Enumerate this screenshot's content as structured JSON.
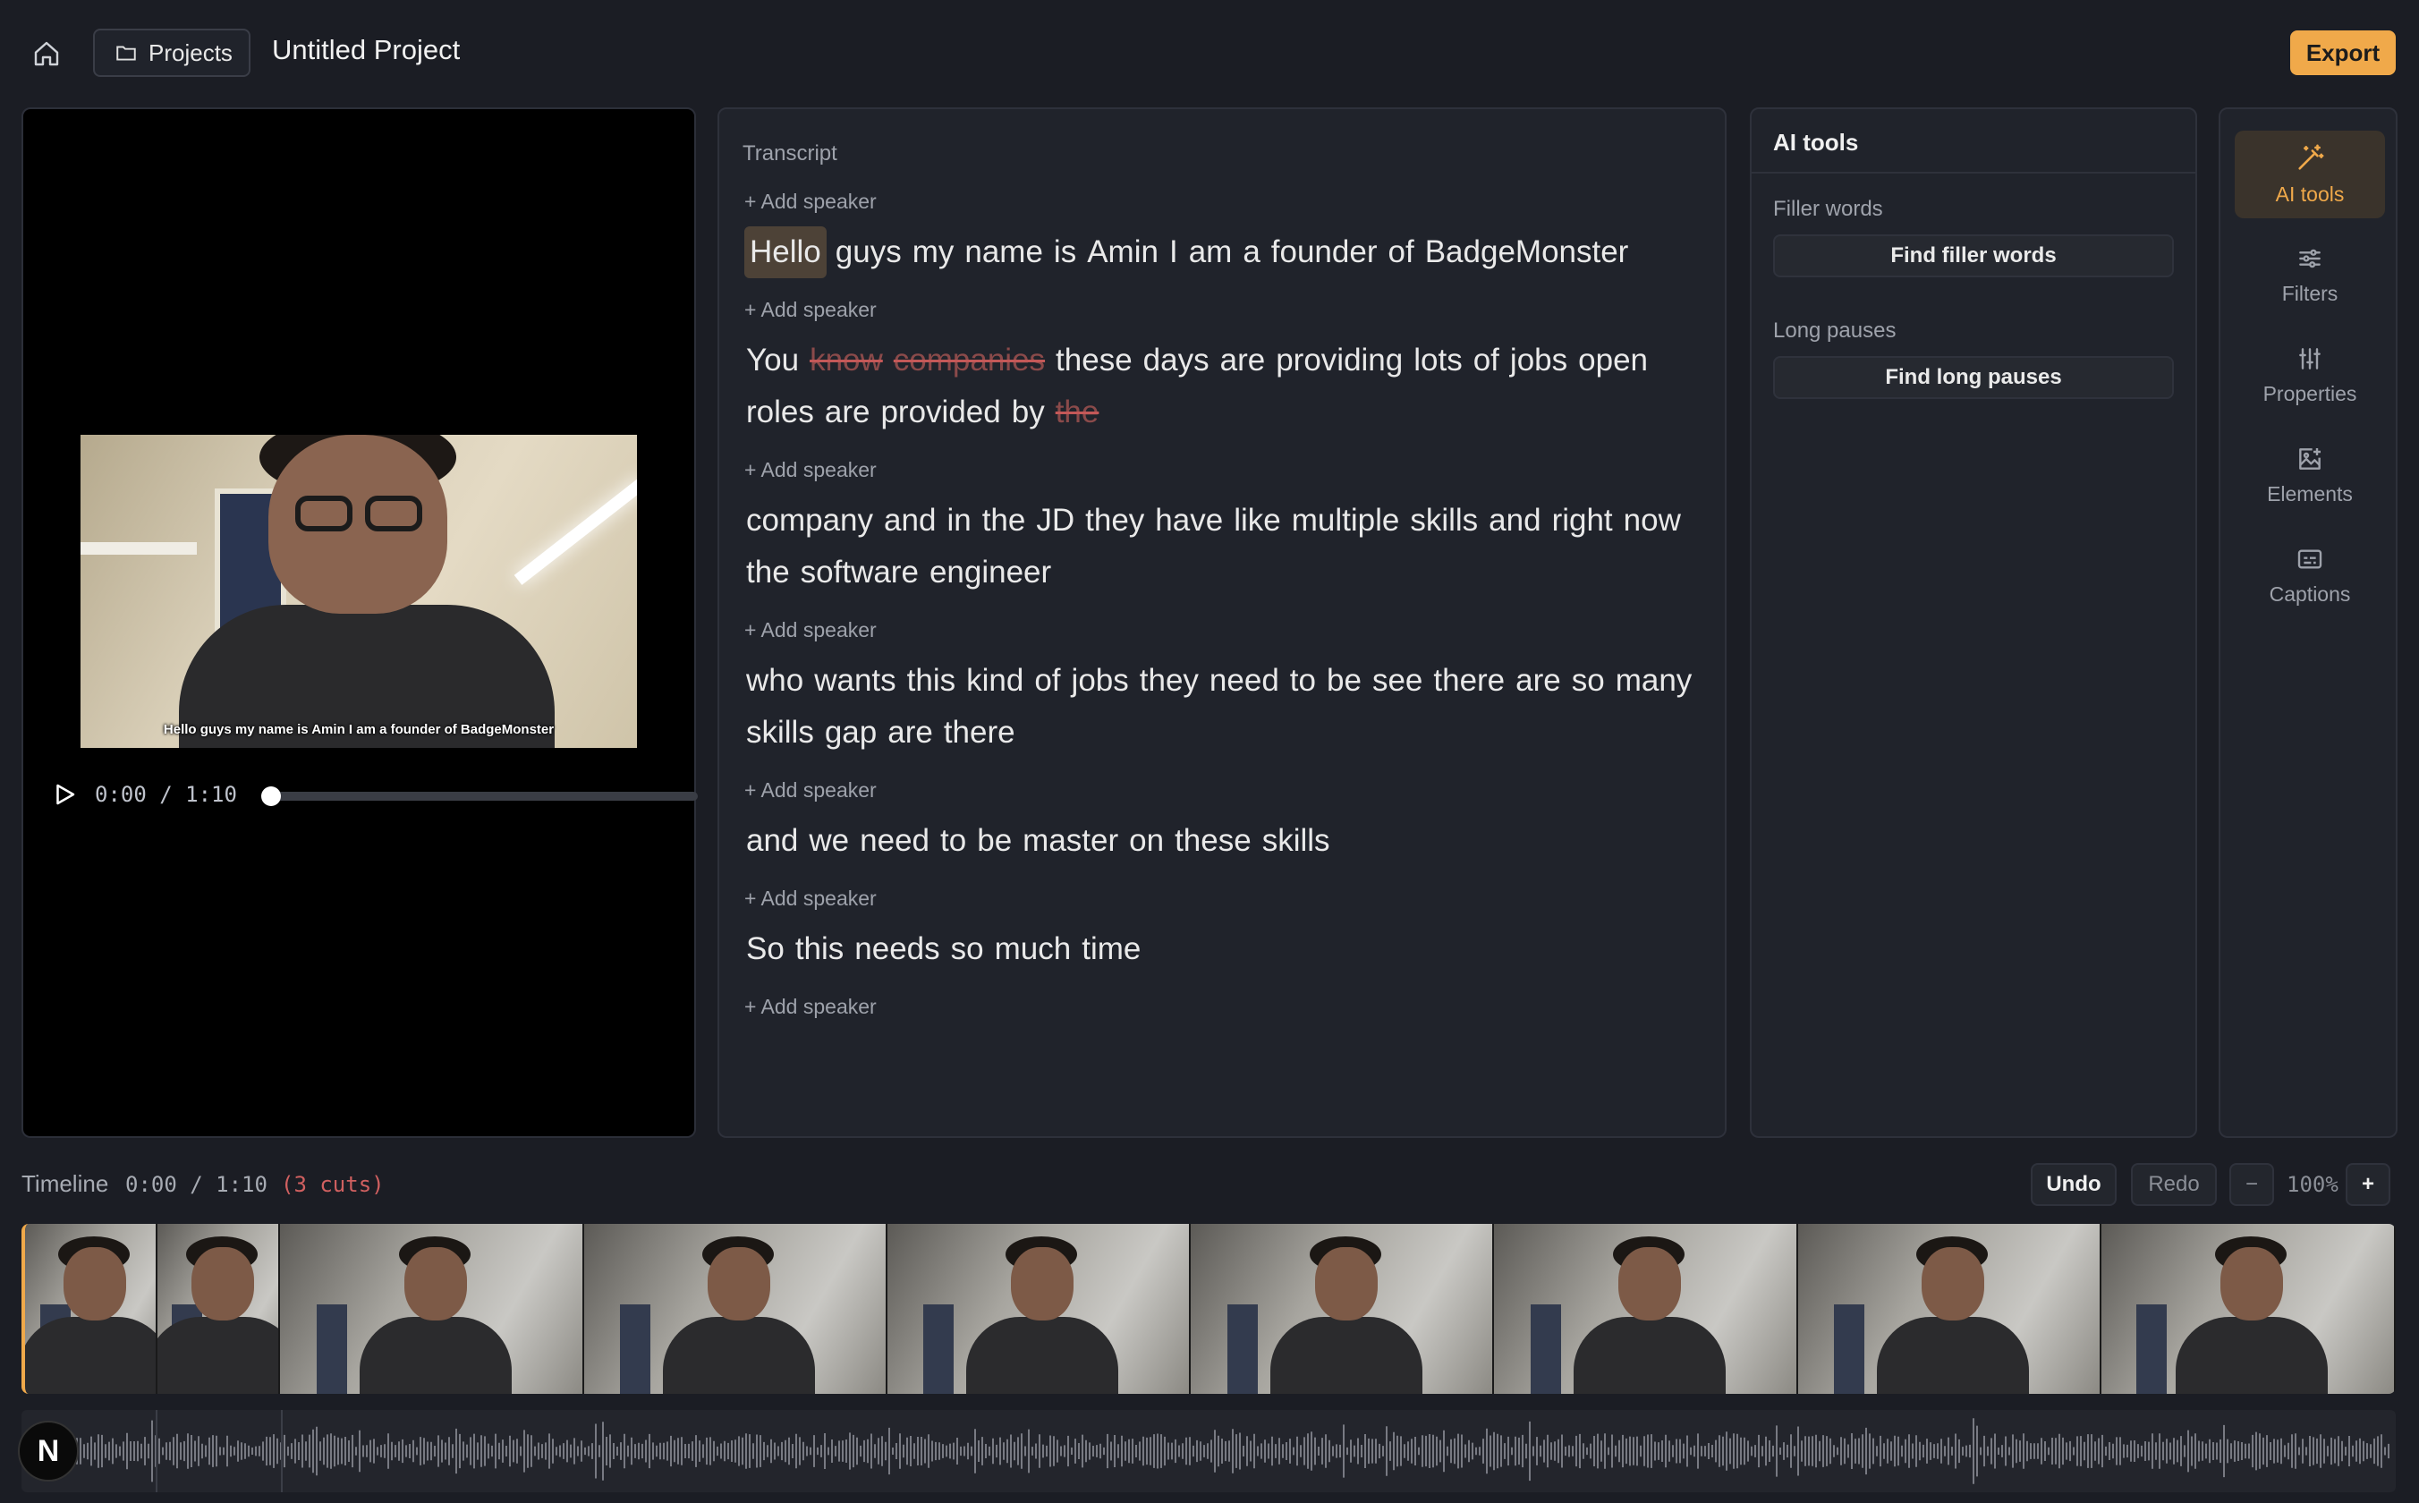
{
  "header": {
    "projects_label": "Projects",
    "project_title": "Untitled Project",
    "export_label": "Export"
  },
  "player": {
    "caption": "Hello guys my name is Amin I am a founder of BadgeMonster",
    "time": "0:00 / 1:10",
    "progress": 0
  },
  "transcript": {
    "label": "Transcript",
    "add_speaker_label": "+ Add speaker",
    "blocks": [
      {
        "words": [
          {
            "t": "Hello",
            "hl": true
          },
          {
            "t": "guys"
          },
          {
            "t": "my"
          },
          {
            "t": "name"
          },
          {
            "t": "is"
          },
          {
            "t": "Amin"
          },
          {
            "t": "I"
          },
          {
            "t": "am"
          },
          {
            "t": "a"
          },
          {
            "t": "founder"
          },
          {
            "t": "of"
          },
          {
            "t": "BadgeMonster"
          }
        ]
      },
      {
        "words": [
          {
            "t": "You"
          },
          {
            "t": "know",
            "cut": true
          },
          {
            "t": "companies",
            "cut": true
          },
          {
            "t": "these"
          },
          {
            "t": "days"
          },
          {
            "t": "are"
          },
          {
            "t": "providing"
          },
          {
            "t": "lots"
          },
          {
            "t": "of"
          },
          {
            "t": "jobs"
          },
          {
            "t": "open"
          },
          {
            "t": "roles"
          },
          {
            "t": "are"
          },
          {
            "t": "provided"
          },
          {
            "t": "by"
          },
          {
            "t": "the",
            "cut": true
          }
        ]
      },
      {
        "words": [
          {
            "t": "company"
          },
          {
            "t": "and"
          },
          {
            "t": "in"
          },
          {
            "t": "the"
          },
          {
            "t": "JD"
          },
          {
            "t": "they"
          },
          {
            "t": "have"
          },
          {
            "t": "like"
          },
          {
            "t": "multiple"
          },
          {
            "t": "skills"
          },
          {
            "t": "and"
          },
          {
            "t": "right"
          },
          {
            "t": "now"
          },
          {
            "t": "the"
          },
          {
            "t": "software"
          },
          {
            "t": "engineer"
          }
        ]
      },
      {
        "words": [
          {
            "t": "who"
          },
          {
            "t": "wants"
          },
          {
            "t": "this"
          },
          {
            "t": "kind"
          },
          {
            "t": "of"
          },
          {
            "t": "jobs"
          },
          {
            "t": "they"
          },
          {
            "t": "need"
          },
          {
            "t": "to"
          },
          {
            "t": "be"
          },
          {
            "t": "see"
          },
          {
            "t": "there"
          },
          {
            "t": "are"
          },
          {
            "t": "so"
          },
          {
            "t": "many"
          },
          {
            "t": "skills"
          },
          {
            "t": "gap"
          },
          {
            "t": "are"
          },
          {
            "t": "there"
          }
        ]
      },
      {
        "words": [
          {
            "t": "and"
          },
          {
            "t": "we"
          },
          {
            "t": "need"
          },
          {
            "t": "to"
          },
          {
            "t": "be"
          },
          {
            "t": "master"
          },
          {
            "t": "on"
          },
          {
            "t": "these"
          },
          {
            "t": "skills"
          }
        ]
      },
      {
        "words": [
          {
            "t": "So"
          },
          {
            "t": "this"
          },
          {
            "t": "needs"
          },
          {
            "t": "so"
          },
          {
            "t": "much"
          },
          {
            "t": "time"
          }
        ]
      },
      {
        "words": []
      }
    ]
  },
  "ai_tools": {
    "title": "AI tools",
    "filler_label": "Filler words",
    "filler_button": "Find filler words",
    "pauses_label": "Long pauses",
    "pauses_button": "Find long pauses"
  },
  "rail": {
    "items": [
      {
        "label": "AI tools",
        "icon": "magic-wand-icon",
        "active": true
      },
      {
        "label": "Filters",
        "icon": "filters-icon",
        "active": false
      },
      {
        "label": "Properties",
        "icon": "sliders-icon",
        "active": false
      },
      {
        "label": "Elements",
        "icon": "image-plus-icon",
        "active": false
      },
      {
        "label": "Captions",
        "icon": "captions-icon",
        "active": false
      }
    ]
  },
  "timeline": {
    "label": "Timeline",
    "time": "0:00 / 1:10",
    "cuts": "(3 cuts)",
    "undo_label": "Undo",
    "redo_label": "Redo",
    "zoom_out_label": "−",
    "zoom_value": "100%",
    "zoom_in_label": "+"
  },
  "badge": {
    "label": "N"
  },
  "colors": {
    "accent": "#f0a94a",
    "cut": "#c45858",
    "highlight": "#4d4237"
  }
}
